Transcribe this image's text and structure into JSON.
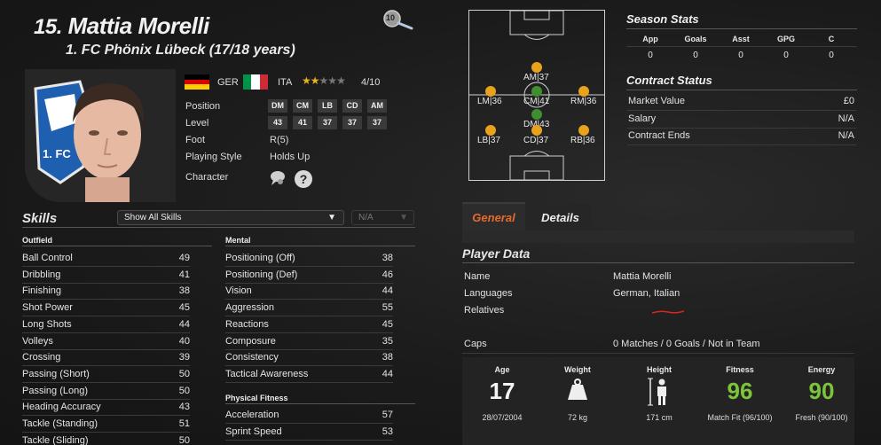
{
  "header": {
    "number": "15.",
    "name": "Mattia Morelli",
    "club_line": "1. FC Phönix Lübeck (17/18 years)",
    "search_badge": "10"
  },
  "bio": {
    "nationalities": [
      {
        "code": "GER",
        "colors": [
          "#000000",
          "#dd0000",
          "#ffce00"
        ]
      },
      {
        "code": "ITA",
        "colors": [
          "#009246",
          "#ffffff",
          "#ce2b37"
        ]
      }
    ],
    "rating_stars": 2,
    "rating_total_stars": 5,
    "rating_text": "4/10",
    "position_label": "Position",
    "positions": [
      "DM",
      "CM",
      "LB",
      "CD",
      "AM"
    ],
    "level_label": "Level",
    "levels": [
      "43",
      "41",
      "37",
      "37",
      "37"
    ],
    "foot_label": "Foot",
    "foot_value": "R(5)",
    "style_label": "Playing Style",
    "style_value": "Holds Up",
    "character_label": "Character",
    "character_icons": [
      "chat-bubble-icon",
      "question-icon"
    ]
  },
  "skills": {
    "title": "Skills",
    "filter": "Show All Skills",
    "secondary_filter": "N/A",
    "outfield_title": "Outfield",
    "outfield": [
      {
        "name": "Ball Control",
        "value": "49"
      },
      {
        "name": "Dribbling",
        "value": "41"
      },
      {
        "name": "Finishing",
        "value": "38"
      },
      {
        "name": "Shot Power",
        "value": "45"
      },
      {
        "name": "Long Shots",
        "value": "44"
      },
      {
        "name": "Volleys",
        "value": "40"
      },
      {
        "name": "Crossing",
        "value": "39"
      },
      {
        "name": "Passing (Short)",
        "value": "50"
      },
      {
        "name": "Passing (Long)",
        "value": "50"
      },
      {
        "name": "Heading Accuracy",
        "value": "43"
      },
      {
        "name": "Tackle (Standing)",
        "value": "51"
      },
      {
        "name": "Tackle (Sliding)",
        "value": "50"
      }
    ],
    "mental_title": "Mental",
    "mental": [
      {
        "name": "Positioning (Off)",
        "value": "38"
      },
      {
        "name": "Positioning (Def)",
        "value": "46"
      },
      {
        "name": "Vision",
        "value": "44"
      },
      {
        "name": "Aggression",
        "value": "55"
      },
      {
        "name": "Reactions",
        "value": "45"
      },
      {
        "name": "Composure",
        "value": "35"
      },
      {
        "name": "Consistency",
        "value": "38"
      },
      {
        "name": "Tactical Awareness",
        "value": "44"
      }
    ],
    "physical_title": "Physical Fitness",
    "physical": [
      {
        "name": "Acceleration",
        "value": "57"
      },
      {
        "name": "Sprint Speed",
        "value": "53"
      }
    ]
  },
  "pitch": {
    "positions": [
      {
        "label": "AM|37",
        "color": "#e8a21b"
      },
      {
        "label": "LM|36",
        "color": "#e8a21b"
      },
      {
        "label": "CM|41",
        "color": "#3e8f2f"
      },
      {
        "label": "RM|36",
        "color": "#e8a21b"
      },
      {
        "label": "DM|43",
        "color": "#3e8f2f"
      },
      {
        "label": "LB|37",
        "color": "#e8a21b"
      },
      {
        "label": "CD|37",
        "color": "#e8a21b"
      },
      {
        "label": "RB|36",
        "color": "#e8a21b"
      }
    ]
  },
  "season_stats": {
    "title": "Season Stats",
    "headers": [
      "App",
      "Goals",
      "Asst",
      "GPG",
      "C"
    ],
    "values": [
      "0",
      "0",
      "0",
      "0",
      "0"
    ]
  },
  "contract": {
    "title": "Contract Status",
    "rows": [
      {
        "label": "Market Value",
        "value": "£0"
      },
      {
        "label": "Salary",
        "value": "N/A"
      },
      {
        "label": "Contract Ends",
        "value": "N/A"
      }
    ]
  },
  "tabs": {
    "general": "General",
    "details": "Details"
  },
  "player_data": {
    "title": "Player Data",
    "rows": [
      {
        "label": "Name",
        "value": "Mattia Morelli"
      },
      {
        "label": "Languages",
        "value": "German, Italian"
      },
      {
        "label": "Relatives",
        "value": ""
      },
      {
        "label": "Caps",
        "value": "0 Matches / 0 Goals / Not in Team"
      }
    ]
  },
  "vitals": {
    "age": {
      "label": "Age",
      "value": "17",
      "sub": "28/07/2004"
    },
    "weight": {
      "label": "Weight",
      "sub": "72 kg"
    },
    "height": {
      "label": "Height",
      "sub": "171 cm"
    },
    "fitness": {
      "label": "Fitness",
      "value": "96",
      "sub": "Match Fit (96/100)"
    },
    "energy": {
      "label": "Energy",
      "value": "90",
      "sub": "Fresh (90/100)"
    },
    "accent": "#7cc43a"
  }
}
